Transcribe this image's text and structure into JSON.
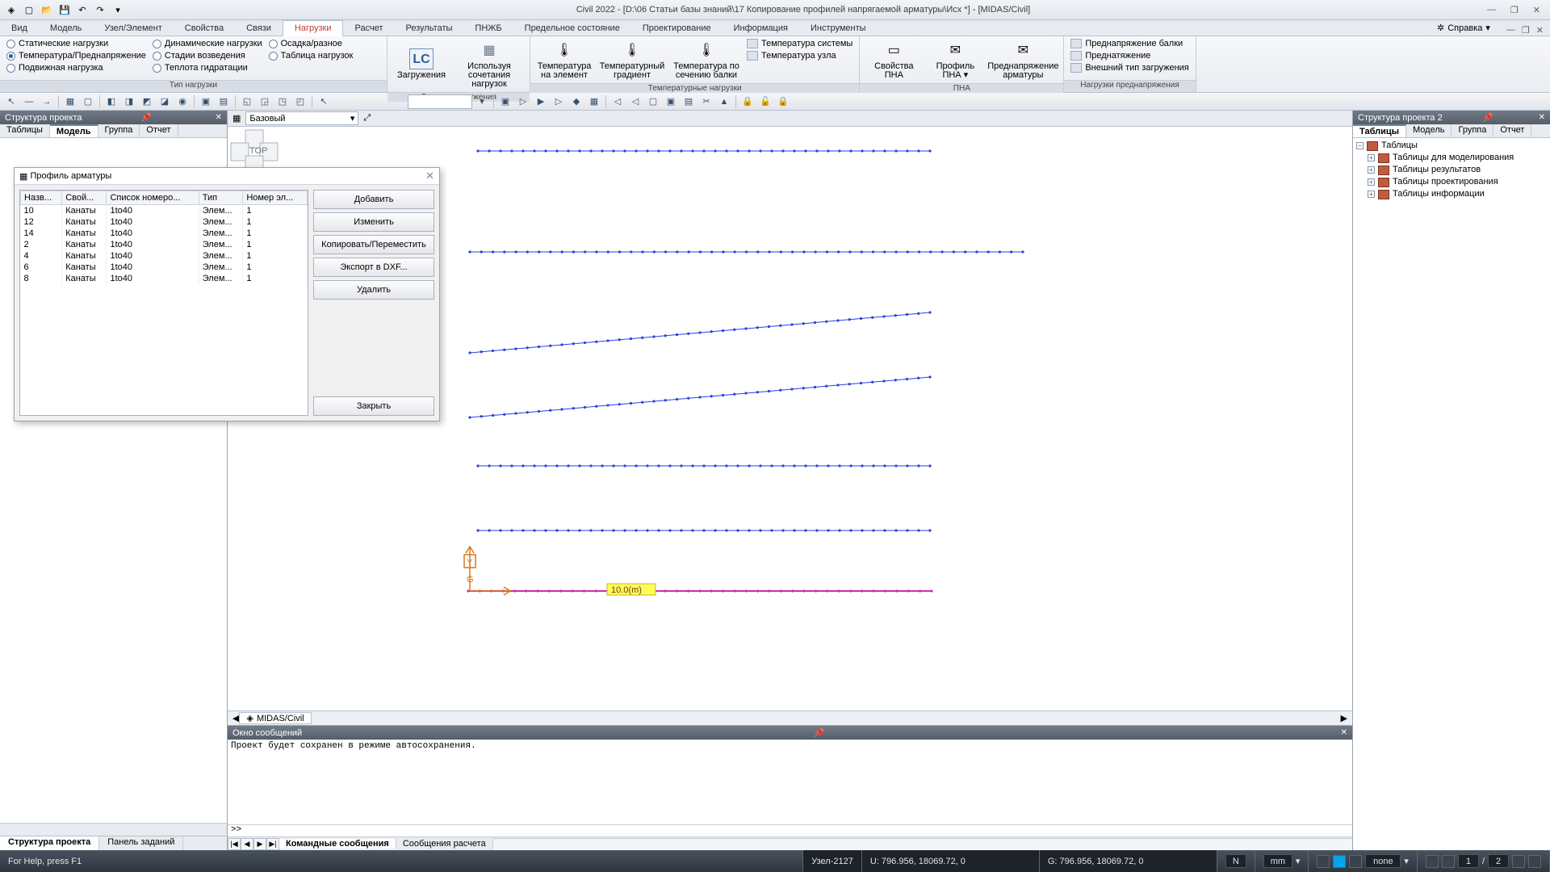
{
  "title": "Civil 2022 - [D:\\06 Статьи базы знаний\\17 Копирование профилей напрягаемой арматуры\\Исх *] - [MIDAS/Civil]",
  "menu": [
    "Вид",
    "Модель",
    "Узел/Элемент",
    "Свойства",
    "Связи",
    "Нагрузки",
    "Расчет",
    "Результаты",
    "ПНЖБ",
    "Предельное состояние",
    "Проектирование",
    "Информация",
    "Инструменты"
  ],
  "menu_active": "Нагрузки",
  "help": "Справка",
  "ribbon": {
    "g1": {
      "label": "Тип нагрузки",
      "col1": [
        {
          "label": "Статические нагрузки",
          "sel": false
        },
        {
          "label": "Температура/Преднапряжение",
          "sel": true
        },
        {
          "label": "Подвижная нагрузка",
          "sel": false
        }
      ],
      "col2": [
        {
          "label": "Динамические нагрузки",
          "sel": false
        },
        {
          "label": "Стадии возведения",
          "sel": false
        },
        {
          "label": "Теплота гидратации",
          "sel": false
        }
      ],
      "col3": [
        {
          "label": "Осадка/разное",
          "sel": false
        },
        {
          "label": "Таблица нагрузок",
          "sel": false
        }
      ]
    },
    "g2": {
      "label": "Создать загружения",
      "btns": [
        {
          "t": "Загружения",
          "i": "LC"
        },
        {
          "t": "Используя сочетания нагрузок",
          "i": "▦"
        }
      ]
    },
    "g3": {
      "label": "Температурные нагрузки",
      "btns": [
        {
          "t": "Температура на элемент",
          "i": "🌡"
        },
        {
          "t": "Температурный градиент",
          "i": "🌡"
        },
        {
          "t": "Температура по сечению балки",
          "i": "🌡"
        }
      ],
      "links": [
        {
          "t": "Температура системы"
        },
        {
          "t": "Температура узла"
        }
      ]
    },
    "g4": {
      "label": "ПНА",
      "btns": [
        {
          "t": "Свойства ПНА",
          "i": "▭"
        },
        {
          "t": "Профиль ПНА ▾",
          "i": "✉"
        },
        {
          "t": "Преднапряжение арматуры",
          "i": "✉"
        }
      ]
    },
    "g5": {
      "label": "Нагрузки преднапряжения",
      "links": [
        {
          "t": "Преднапряжение балки"
        },
        {
          "t": "Преднатяжение"
        },
        {
          "t": "Внешний тип загружения"
        }
      ]
    }
  },
  "view_combo": "Базовый",
  "doc_tab": "MIDAS/Civil",
  "left": {
    "title": "Структура проекта",
    "tabs": [
      "Таблицы",
      "Модель",
      "Группа",
      "Отчет"
    ],
    "active": "Модель",
    "bottom": [
      "Структура проекта",
      "Панель заданий"
    ],
    "bottom_active": "Структура проекта"
  },
  "right": {
    "title": "Структура проекта  2",
    "tabs": [
      "Таблицы",
      "Модель",
      "Группа",
      "Отчет"
    ],
    "active": "Таблицы",
    "tree": [
      {
        "l": "Таблицы",
        "root": true
      },
      {
        "l": "Таблицы для моделирования"
      },
      {
        "l": "Таблицы результатов"
      },
      {
        "l": "Таблицы проектирования"
      },
      {
        "l": "Таблицы информации"
      }
    ]
  },
  "dialog": {
    "title": "Профиль арматуры",
    "cols": [
      "Назв...",
      "Свой...",
      "Список номеро...",
      "Тип",
      "Номер эл..."
    ],
    "rows": [
      [
        "10",
        "Канаты",
        "1to40",
        "Элем...",
        "1"
      ],
      [
        "12",
        "Канаты",
        "1to40",
        "Элем...",
        "1"
      ],
      [
        "14",
        "Канаты",
        "1to40",
        "Элем...",
        "1"
      ],
      [
        "2",
        "Канаты",
        "1to40",
        "Элем...",
        "1"
      ],
      [
        "4",
        "Канаты",
        "1to40",
        "Элем...",
        "1"
      ],
      [
        "6",
        "Канаты",
        "1to40",
        "Элем...",
        "1"
      ],
      [
        "8",
        "Канаты",
        "1to40",
        "Элем...",
        "1"
      ]
    ],
    "btns": [
      "Добавить",
      "Изменить",
      "Копировать/Переместить",
      "Экспорт в DXF...",
      "Удалить"
    ],
    "close": "Закрыть"
  },
  "msg": {
    "title": "Окно сообщений",
    "text": "Проект будет сохранен в режиме автосохранения.",
    "prompt": ">>",
    "tabs": [
      "Командные сообщения",
      "Сообщения расчета"
    ],
    "active": "Командные сообщения"
  },
  "status": {
    "help": "For Help, press F1",
    "node": "Узел-2127",
    "u": "U: 796.956, 18069.72, 0",
    "g": "G: 796.956, 18069.72, 0",
    "n": "N",
    "unit1": "mm",
    "unit2": "▾",
    "none": "none",
    "one": "1",
    "slash": "/",
    "two": "2"
  },
  "axis_label": "10.0(m)"
}
